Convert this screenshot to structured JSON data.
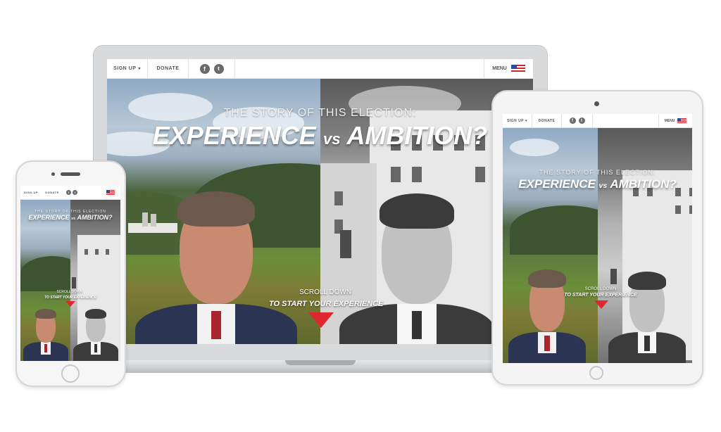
{
  "nav": {
    "signup_label": "SIGN UP",
    "donate_label": "DONATE",
    "menu_label": "MENU",
    "facebook_glyph": "f",
    "twitter_glyph": "t",
    "facebook_icon": "facebook-icon",
    "twitter_icon": "twitter-icon",
    "flag_icon": "us-flag-icon"
  },
  "hero": {
    "kicker": "THE STORY OF THIS ELECTION:",
    "headline_left": "EXPERIENCE",
    "headline_vs": "vs",
    "headline_right": "AMBITION?",
    "scroll_label": "SCROLL DOWN",
    "cta_label": "TO START YOUR EXPERIENCE"
  },
  "tablet": {
    "kicker": "THE STORY OF THIS ELECTION:"
  },
  "phone": {
    "signup_label": "SIGN-UP",
    "kicker": "THE STORY OF THIS ELECTION",
    "scroll_label": "SCROLL DOWN",
    "cta_label": "TO START YOUR EXPERIENCE"
  },
  "colors": {
    "accent_heart": "#e0272f",
    "flag_blue": "#2b4aa0",
    "flag_red": "#d0232c",
    "suit": "#2b3553"
  }
}
